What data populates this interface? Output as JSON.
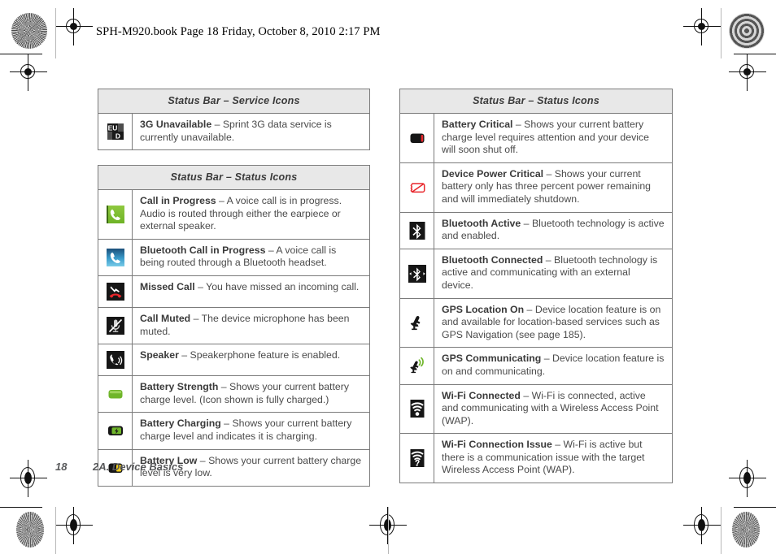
{
  "header": {
    "running_head": "SPH-M920.book  Page 18  Friday, October 8, 2010  2:17 PM"
  },
  "footer": {
    "page_number": "18",
    "chapter": "2A. Device Basics"
  },
  "tables": [
    {
      "id": "service-icons",
      "title": "Status Bar – Service Icons",
      "rows": [
        {
          "icon": "3g-unavailable-icon",
          "term": "3G Unavailable",
          "dash": " – ",
          "desc": "Sprint 3G data service is currently unavailable."
        }
      ]
    },
    {
      "id": "status-icons-left",
      "title": "Status Bar – Status Icons",
      "rows": [
        {
          "icon": "call-in-progress-icon",
          "term": "Call in Progress",
          "dash": " – ",
          "desc": "A voice call is in progress. Audio is routed through either the earpiece or external speaker."
        },
        {
          "icon": "bluetooth-call-in-progress-icon",
          "term": "Bluetooth Call in Progress",
          "dash": " – ",
          "desc": "A voice call is being routed through a Bluetooth headset."
        },
        {
          "icon": "missed-call-icon",
          "term": "Missed Call",
          "dash": " – ",
          "desc": "You have missed an incoming call."
        },
        {
          "icon": "call-muted-icon",
          "term": "Call Muted",
          "dash": " – ",
          "desc": "The device microphone has been muted."
        },
        {
          "icon": "speaker-icon",
          "term": "Speaker",
          "dash": " – ",
          "desc": "Speakerphone feature is enabled."
        },
        {
          "icon": "battery-strength-icon",
          "term": "Battery Strength",
          "dash": " – ",
          "desc": "Shows your current battery charge level. (Icon shown is fully charged.)"
        },
        {
          "icon": "battery-charging-icon",
          "term": "Battery Charging",
          "dash": " – ",
          "desc": "Shows your current battery charge level and indicates it is charging."
        },
        {
          "icon": "battery-low-icon",
          "term": "Battery Low",
          "dash": " – ",
          "desc": "Shows your current battery charge level is very low."
        }
      ]
    },
    {
      "id": "status-icons-right",
      "title": "Status Bar – Status Icons",
      "rows": [
        {
          "icon": "battery-critical-icon",
          "term": "Battery Critical",
          "dash": " – ",
          "desc": "Shows your current battery charge level requires attention and your device will soon shut off."
        },
        {
          "icon": "device-power-critical-icon",
          "term": "Device Power Critical",
          "dash": " – ",
          "desc": "Shows your current battery only has three percent power remaining and will immediately shutdown."
        },
        {
          "icon": "bluetooth-active-icon",
          "term": "Bluetooth Active",
          "dash": " – ",
          "desc": "Bluetooth technology is active and enabled."
        },
        {
          "icon": "bluetooth-connected-icon",
          "term": "Bluetooth Connected",
          "dash": " – ",
          "desc": "Bluetooth technology is active and communicating with an external device."
        },
        {
          "icon": "gps-location-on-icon",
          "term": "GPS Location On",
          "dash": " – ",
          "desc": "Device location feature is on and available for location-based services such as GPS Navigation (see page 185)."
        },
        {
          "icon": "gps-communicating-icon",
          "term": "GPS Communicating",
          "dash": " – ",
          "desc": "Device location feature is on and communicating."
        },
        {
          "icon": "wifi-connected-icon",
          "term": "Wi-Fi Connected",
          "dash": " – ",
          "desc": "Wi-Fi is connected, active and communicating with a Wireless Access Point (WAP)."
        },
        {
          "icon": "wifi-connection-issue-icon",
          "term": "Wi-Fi Connection Issue",
          "dash": " – ",
          "desc": "Wi-Fi is active but there is a communication issue with the target Wireless Access Point (WAP)."
        }
      ]
    }
  ],
  "colors": {
    "header_bg": "#e8e8e8",
    "border": "#7b7b7b",
    "text": "#4a4a4a",
    "green": "#7dc142",
    "blue": "#2f9ad0",
    "red": "#e8262b",
    "yellow": "#f5d11a",
    "black": "#161616"
  }
}
